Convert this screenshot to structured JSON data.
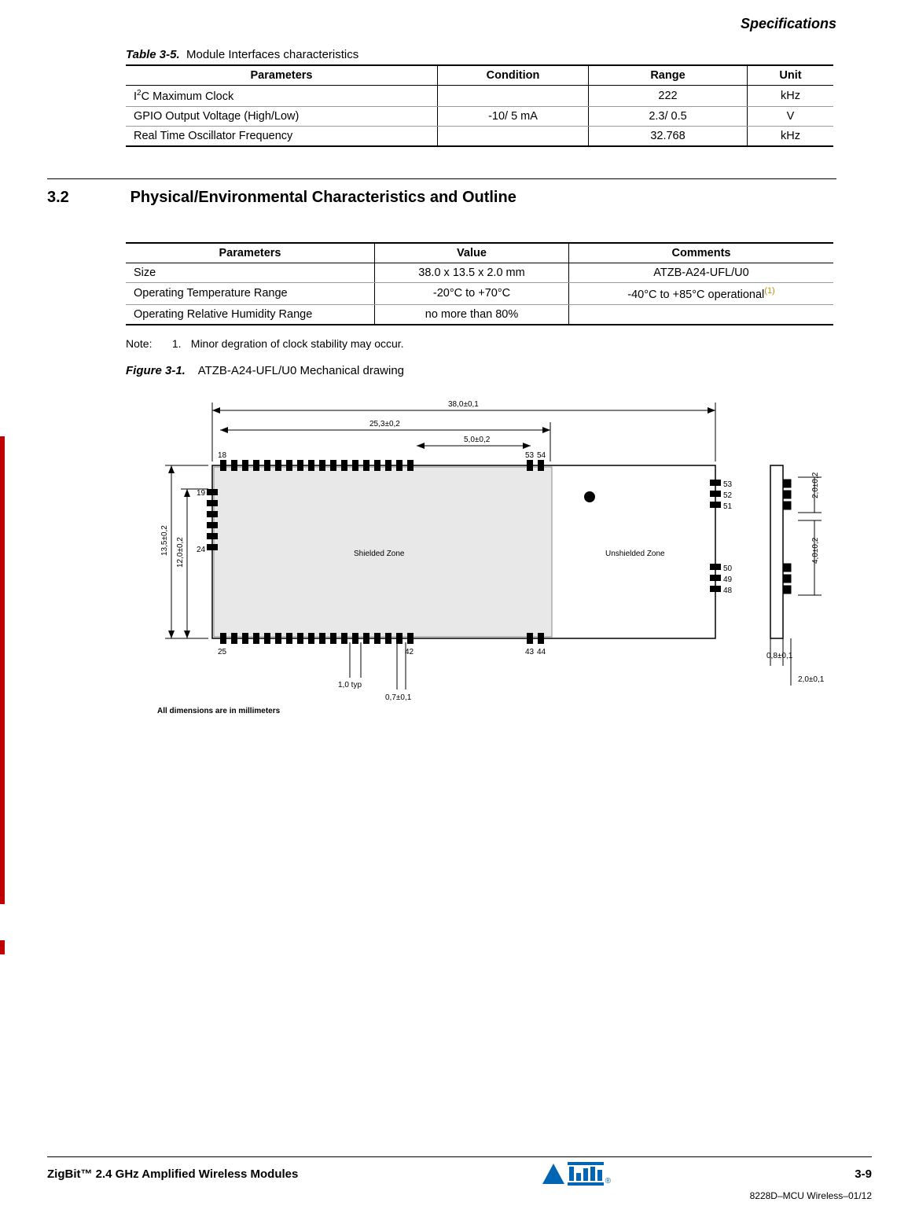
{
  "header": {
    "section_title": "Specifications"
  },
  "table35": {
    "caption_label": "Table 3-5.",
    "caption_text": "Module Interfaces characteristics",
    "headers": {
      "c0": "Parameters",
      "c1": "Condition",
      "c2": "Range",
      "c3": "Unit"
    },
    "rows": [
      {
        "param_prefix": "I",
        "param_sup": "2",
        "param_suffix": "C Maximum Clock",
        "condition": "",
        "range": "222",
        "unit": "kHz"
      },
      {
        "param": "GPIO Output Voltage (High/Low)",
        "condition": "-10/ 5 mA",
        "range": "2.3/ 0.5",
        "unit": "V"
      },
      {
        "param": "Real Time Oscillator Frequency",
        "condition": "",
        "range": "32.768",
        "unit": "kHz"
      }
    ]
  },
  "section32": {
    "number": "3.2",
    "title": "Physical/Environmental Characteristics and Outline"
  },
  "table_phys": {
    "headers": {
      "c0": "Parameters",
      "c1": "Value",
      "c2": "Comments"
    },
    "rows": [
      {
        "param": "Size",
        "value": "38.0 x 13.5 x 2.0 mm",
        "comment": "ATZB-A24-UFL/U0"
      },
      {
        "param": "Operating Temperature Range",
        "value": "-20°C to +70°C",
        "comment": "-40°C to +85°C operational",
        "noteref": "(1)"
      },
      {
        "param": "Operating Relative Humidity Range",
        "value": "no more than 80%",
        "comment": ""
      }
    ]
  },
  "note": {
    "label": "Note:",
    "index": "1.",
    "text": "Minor degration of clock stability may occur."
  },
  "figure31": {
    "label": "Figure 3-1.",
    "text": "ATZB-A24-UFL/U0 Mechanical drawing"
  },
  "drawing": {
    "dim_total_w": "38,0±0,1",
    "dim_inner_w": "25,3±0,2",
    "dim_gap": "5,0±0,2",
    "dim_h": "13,5±0,2",
    "dim_h_inner": "12,0±0,2",
    "dim_side_2": "2,0±0,2",
    "dim_side_4": "4,0±0,2",
    "dim_thick": "0,8±0,1",
    "dim_thick2": "2,0±0,1",
    "pitch": "1,0 typ",
    "pad": "0,7±0,1",
    "label_shielded": "Shielded Zone",
    "label_unshielded": "Unshielded Zone",
    "pin18": "18",
    "pin19": "19",
    "pin24": "24",
    "pin25": "25",
    "pin42": "42",
    "pin43": "43",
    "pin44": "44",
    "pin48": "48",
    "pin49": "49",
    "pin50": "50",
    "pin51": "51",
    "pin52": "52",
    "pin53": "53",
    "pin54": "54",
    "footnote": "All dimensions are in millimeters"
  },
  "footer": {
    "left": "ZigBit™ 2.4 GHz Amplified Wireless Modules",
    "page": "3-9",
    "doc": "8228D–MCU Wireless–01/12"
  }
}
